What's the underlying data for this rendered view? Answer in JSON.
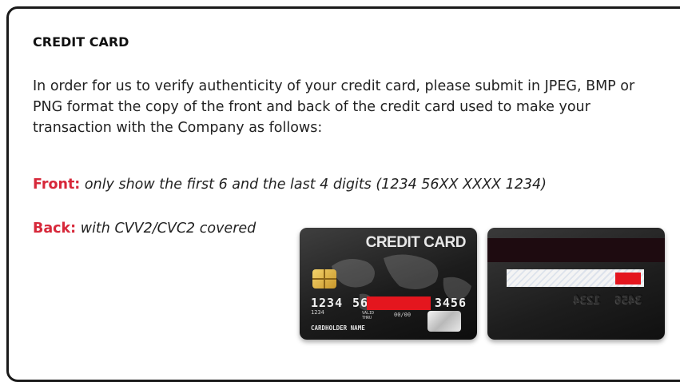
{
  "section_title": "CREDIT CARD",
  "intro_lines": [
    "In order for us to verify authenticity of your credit card, please submit in JPEG, BMP or",
    "PNG format the copy of the front and back of the credit card used to make your",
    "transaction with the Company as follows:"
  ],
  "front": {
    "label": "Front:",
    "text": "only show the first 6 and the last 4 digits (1234 56XX XXXX 1234)"
  },
  "back": {
    "label": "Back:",
    "text": "with CVV2/CVC2 covered"
  },
  "card_front": {
    "title": "CREDIT CARD",
    "digits_first": "1234",
    "digits_second": "56",
    "digits_last": "3456",
    "small_digits": "1234",
    "valid_thru": "VALID THRU",
    "expiry": "00/00",
    "holder": "CARDHOLDER NAME"
  },
  "colors": {
    "label_red": "#d7283a",
    "redaction_red": "#e4161e",
    "border": "#1a1a1a"
  }
}
